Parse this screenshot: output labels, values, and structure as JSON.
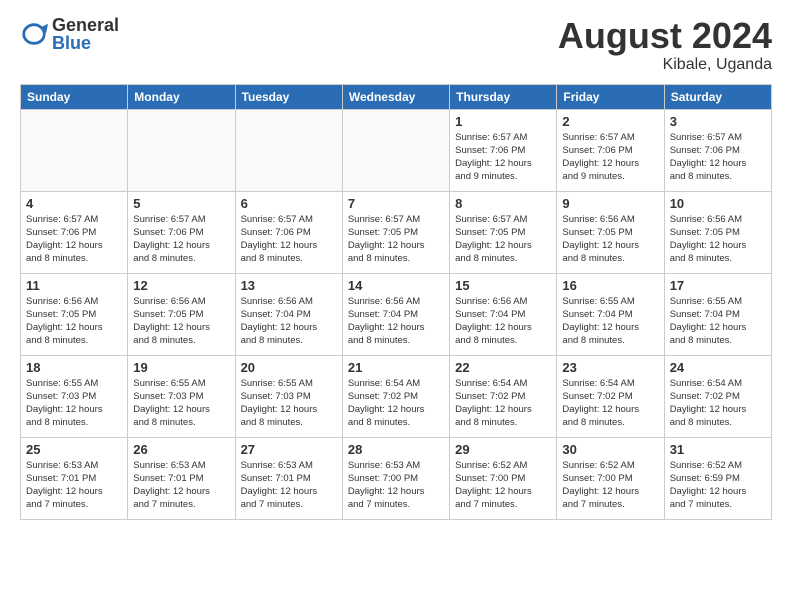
{
  "logo": {
    "general": "General",
    "blue": "Blue"
  },
  "title": "August 2024",
  "subtitle": "Kibale, Uganda",
  "headers": [
    "Sunday",
    "Monday",
    "Tuesday",
    "Wednesday",
    "Thursday",
    "Friday",
    "Saturday"
  ],
  "weeks": [
    [
      {
        "day": "",
        "info": ""
      },
      {
        "day": "",
        "info": ""
      },
      {
        "day": "",
        "info": ""
      },
      {
        "day": "",
        "info": ""
      },
      {
        "day": "1",
        "info": "Sunrise: 6:57 AM\nSunset: 7:06 PM\nDaylight: 12 hours\nand 9 minutes."
      },
      {
        "day": "2",
        "info": "Sunrise: 6:57 AM\nSunset: 7:06 PM\nDaylight: 12 hours\nand 9 minutes."
      },
      {
        "day": "3",
        "info": "Sunrise: 6:57 AM\nSunset: 7:06 PM\nDaylight: 12 hours\nand 8 minutes."
      }
    ],
    [
      {
        "day": "4",
        "info": "Sunrise: 6:57 AM\nSunset: 7:06 PM\nDaylight: 12 hours\nand 8 minutes."
      },
      {
        "day": "5",
        "info": "Sunrise: 6:57 AM\nSunset: 7:06 PM\nDaylight: 12 hours\nand 8 minutes."
      },
      {
        "day": "6",
        "info": "Sunrise: 6:57 AM\nSunset: 7:06 PM\nDaylight: 12 hours\nand 8 minutes."
      },
      {
        "day": "7",
        "info": "Sunrise: 6:57 AM\nSunset: 7:05 PM\nDaylight: 12 hours\nand 8 minutes."
      },
      {
        "day": "8",
        "info": "Sunrise: 6:57 AM\nSunset: 7:05 PM\nDaylight: 12 hours\nand 8 minutes."
      },
      {
        "day": "9",
        "info": "Sunrise: 6:56 AM\nSunset: 7:05 PM\nDaylight: 12 hours\nand 8 minutes."
      },
      {
        "day": "10",
        "info": "Sunrise: 6:56 AM\nSunset: 7:05 PM\nDaylight: 12 hours\nand 8 minutes."
      }
    ],
    [
      {
        "day": "11",
        "info": "Sunrise: 6:56 AM\nSunset: 7:05 PM\nDaylight: 12 hours\nand 8 minutes."
      },
      {
        "day": "12",
        "info": "Sunrise: 6:56 AM\nSunset: 7:05 PM\nDaylight: 12 hours\nand 8 minutes."
      },
      {
        "day": "13",
        "info": "Sunrise: 6:56 AM\nSunset: 7:04 PM\nDaylight: 12 hours\nand 8 minutes."
      },
      {
        "day": "14",
        "info": "Sunrise: 6:56 AM\nSunset: 7:04 PM\nDaylight: 12 hours\nand 8 minutes."
      },
      {
        "day": "15",
        "info": "Sunrise: 6:56 AM\nSunset: 7:04 PM\nDaylight: 12 hours\nand 8 minutes."
      },
      {
        "day": "16",
        "info": "Sunrise: 6:55 AM\nSunset: 7:04 PM\nDaylight: 12 hours\nand 8 minutes."
      },
      {
        "day": "17",
        "info": "Sunrise: 6:55 AM\nSunset: 7:04 PM\nDaylight: 12 hours\nand 8 minutes."
      }
    ],
    [
      {
        "day": "18",
        "info": "Sunrise: 6:55 AM\nSunset: 7:03 PM\nDaylight: 12 hours\nand 8 minutes."
      },
      {
        "day": "19",
        "info": "Sunrise: 6:55 AM\nSunset: 7:03 PM\nDaylight: 12 hours\nand 8 minutes."
      },
      {
        "day": "20",
        "info": "Sunrise: 6:55 AM\nSunset: 7:03 PM\nDaylight: 12 hours\nand 8 minutes."
      },
      {
        "day": "21",
        "info": "Sunrise: 6:54 AM\nSunset: 7:02 PM\nDaylight: 12 hours\nand 8 minutes."
      },
      {
        "day": "22",
        "info": "Sunrise: 6:54 AM\nSunset: 7:02 PM\nDaylight: 12 hours\nand 8 minutes."
      },
      {
        "day": "23",
        "info": "Sunrise: 6:54 AM\nSunset: 7:02 PM\nDaylight: 12 hours\nand 8 minutes."
      },
      {
        "day": "24",
        "info": "Sunrise: 6:54 AM\nSunset: 7:02 PM\nDaylight: 12 hours\nand 8 minutes."
      }
    ],
    [
      {
        "day": "25",
        "info": "Sunrise: 6:53 AM\nSunset: 7:01 PM\nDaylight: 12 hours\nand 7 minutes."
      },
      {
        "day": "26",
        "info": "Sunrise: 6:53 AM\nSunset: 7:01 PM\nDaylight: 12 hours\nand 7 minutes."
      },
      {
        "day": "27",
        "info": "Sunrise: 6:53 AM\nSunset: 7:01 PM\nDaylight: 12 hours\nand 7 minutes."
      },
      {
        "day": "28",
        "info": "Sunrise: 6:53 AM\nSunset: 7:00 PM\nDaylight: 12 hours\nand 7 minutes."
      },
      {
        "day": "29",
        "info": "Sunrise: 6:52 AM\nSunset: 7:00 PM\nDaylight: 12 hours\nand 7 minutes."
      },
      {
        "day": "30",
        "info": "Sunrise: 6:52 AM\nSunset: 7:00 PM\nDaylight: 12 hours\nand 7 minutes."
      },
      {
        "day": "31",
        "info": "Sunrise: 6:52 AM\nSunset: 6:59 PM\nDaylight: 12 hours\nand 7 minutes."
      }
    ]
  ]
}
